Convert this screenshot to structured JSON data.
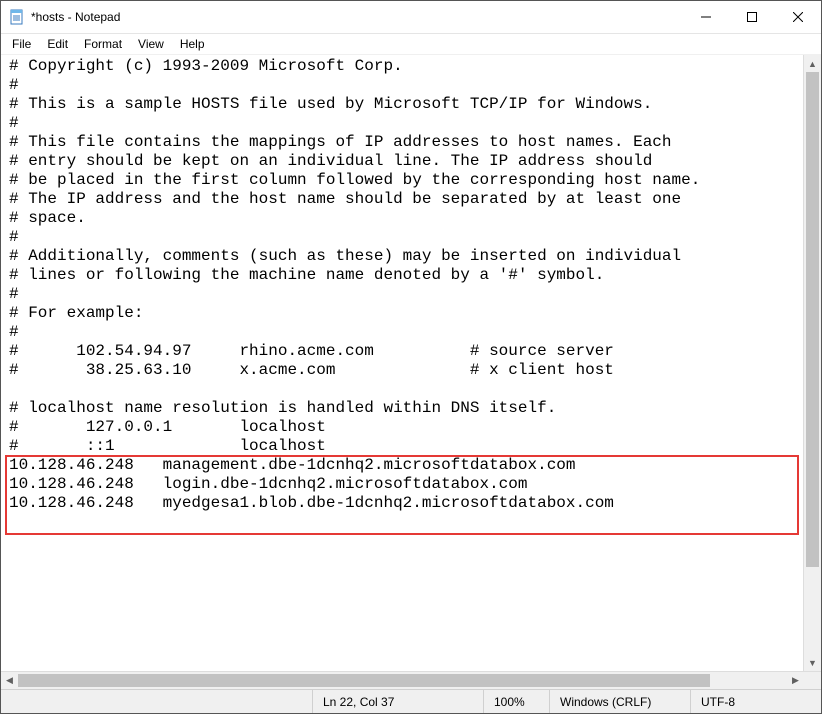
{
  "window": {
    "title": "*hosts - Notepad"
  },
  "menu": {
    "file": "File",
    "edit": "Edit",
    "format": "Format",
    "view": "View",
    "help": "Help"
  },
  "content": {
    "lines": [
      "# Copyright (c) 1993-2009 Microsoft Corp.",
      "#",
      "# This is a sample HOSTS file used by Microsoft TCP/IP for Windows.",
      "#",
      "# This file contains the mappings of IP addresses to host names. Each",
      "# entry should be kept on an individual line. The IP address should",
      "# be placed in the first column followed by the corresponding host name.",
      "# The IP address and the host name should be separated by at least one",
      "# space.",
      "#",
      "# Additionally, comments (such as these) may be inserted on individual",
      "# lines or following the machine name denoted by a '#' symbol.",
      "#",
      "# For example:",
      "#",
      "#      102.54.94.97     rhino.acme.com          # source server",
      "#       38.25.63.10     x.acme.com              # x client host",
      "",
      "# localhost name resolution is handled within DNS itself.",
      "#       127.0.0.1       localhost",
      "#       ::1             localhost",
      "10.128.46.248   management.dbe-1dcnhq2.microsoftdatabox.com",
      "10.128.46.248   login.dbe-1dcnhq2.microsoftdatabox.com",
      "10.128.46.248   myedgesa1.blob.dbe-1dcnhq2.microsoftdatabox.com"
    ],
    "highlight_start_line": 21,
    "highlight_line_count": 4
  },
  "status": {
    "position": "Ln 22, Col 37",
    "zoom": "100%",
    "line_ending": "Windows (CRLF)",
    "encoding": "UTF-8"
  }
}
